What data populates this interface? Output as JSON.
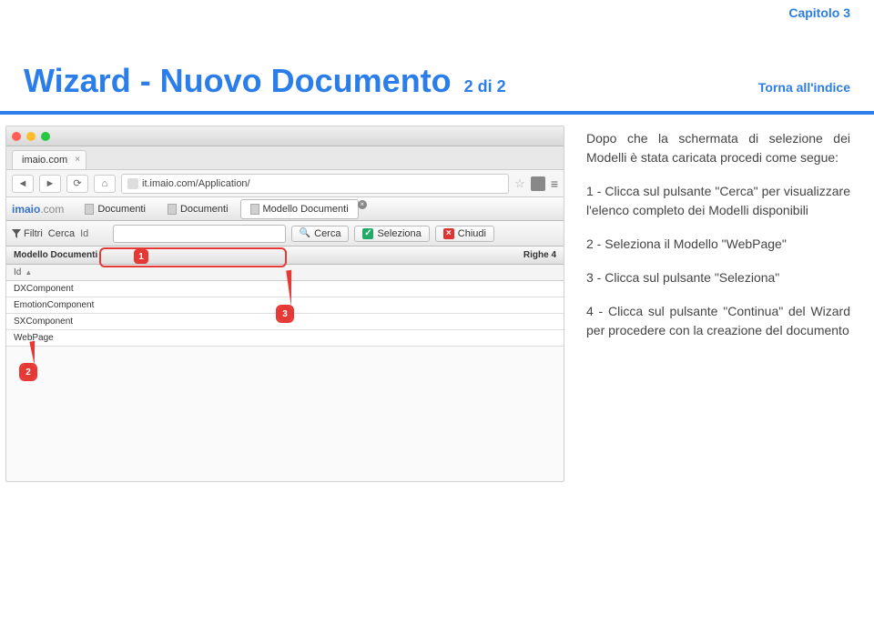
{
  "chapter": "Capitolo 3",
  "title": "Wizard - Nuovo Documento",
  "title_sub": "2 di 2",
  "back_link": "Torna all'indice",
  "browser": {
    "tab_title": "imaio.com",
    "url": "it.imaio.com/Application/"
  },
  "app": {
    "logo_a": "imaio",
    "logo_b": ".com",
    "tabs": [
      "Documenti",
      "Documenti",
      "Modello Documenti"
    ]
  },
  "toolbar": {
    "filtri": "Filtri",
    "cerca_label": "Cerca",
    "id": "Id",
    "search_placeholder": "",
    "cerca_btn": "Cerca",
    "seleziona_btn": "Seleziona",
    "chiudi_btn": "Chiudi"
  },
  "grid": {
    "header_title": "Modello Documenti",
    "righe_label": "Righe",
    "righe_count": "4",
    "id_col": "Id",
    "rows": [
      "DXComponent",
      "EmotionComponent",
      "SXComponent",
      "WebPage"
    ]
  },
  "callouts": {
    "1": "1",
    "2": "2",
    "3": "3"
  },
  "desc": {
    "p1": "Dopo che la schermata di selezione dei Modelli è stata caricata procedi come segue:",
    "p2": "1 - Clicca sul pulsante \"Cerca\" per visualizzare l'elenco completo dei Modelli disponibili",
    "p3": "2 - Seleziona il Modello \"WebPage\"",
    "p4": "3 - Clicca sul pulsante \"Seleziona\"",
    "p5": "4 - Clicca sul pulsante \"Continua\" del Wizard per procedere con la creazione del documento"
  }
}
